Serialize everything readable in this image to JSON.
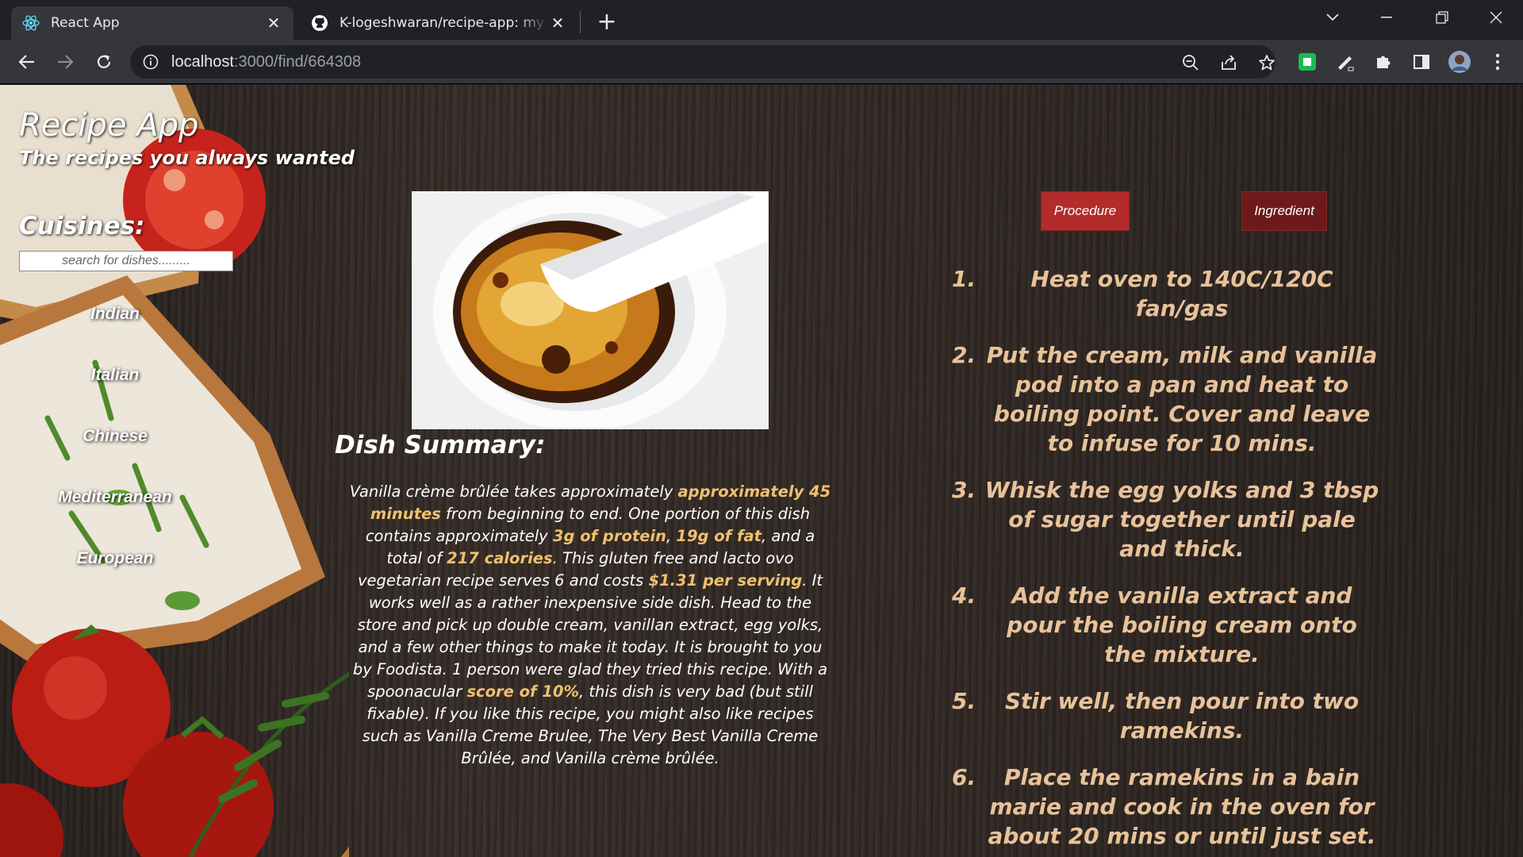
{
  "browser": {
    "tabs": [
      {
        "title": "React App",
        "icon": "react-icon",
        "active": true
      },
      {
        "title": "K-logeshwaran/recipe-app: my first",
        "icon": "github-icon",
        "active": false
      }
    ],
    "url": {
      "host": "localhost",
      "path": ":3000/find/664308"
    }
  },
  "app": {
    "title": "Recipe App",
    "tagline": "The recipes you always wanted"
  },
  "sidebar": {
    "heading": "Cuisines:",
    "search_placeholder": "search for dishes.........",
    "cuisines": [
      "Indian",
      "Italian",
      "Chinese",
      "Mediterranean",
      "European"
    ]
  },
  "dish": {
    "image_subject": "creme-brulee-photo",
    "summary_heading": "Dish Summary:",
    "summary": {
      "t1": "Vanilla crème brûlée takes approximately ",
      "b1": "approximately 45 minutes",
      "t2": " from beginning to end. One portion of this dish contains approximately ",
      "b2": "3g of protein",
      "t3": ", ",
      "b3": "19g of fat",
      "t4": ", and a total of ",
      "b4": "217 calories",
      "t5": ". This gluten free and lacto ovo vegetarian recipe serves 6 and costs ",
      "b5": "$1.31 per serving",
      "t6": ". It works well as a rather inexpensive side dish. Head to the store and pick up double cream, vanillan extract, egg yolks, and a few other things to make it today. It is brought to you by Foodista. 1 person were glad they tried this recipe. With a spoonacular ",
      "b6": "score of 10%",
      "t7": ", this dish is very bad (but still fixable). If you like this recipe, you might also like recipes such as Vanilla Creme Brulee, The Very Best Vanilla Creme Brûlée, and Vanilla crème brûlée."
    }
  },
  "details": {
    "procedure_label": "Procedure",
    "ingredient_label": "Ingredient",
    "steps": [
      "Heat oven to 140C/120C fan/gas",
      "Put the cream, milk and vanilla pod into a pan and heat to boiling point. Cover and leave to infuse for 10 mins.",
      "Whisk the egg yolks and 3 tbsp of sugar together until pale and thick.",
      "Add the vanilla extract and pour the boiling cream onto the mixture.",
      "Stir well, then pour into two ramekins.",
      "Place the ramekins in a bain marie and cook in the oven for about 20 mins or until just set."
    ],
    "step_numbers": [
      "1.",
      "2.",
      "3.",
      "4.",
      "5.",
      "6."
    ]
  },
  "colors": {
    "accent_text": "#e8c29a",
    "highlight": "#f0c070",
    "procedure_button": "#b32b2b",
    "ingredient_button": "#6e1a1a"
  }
}
